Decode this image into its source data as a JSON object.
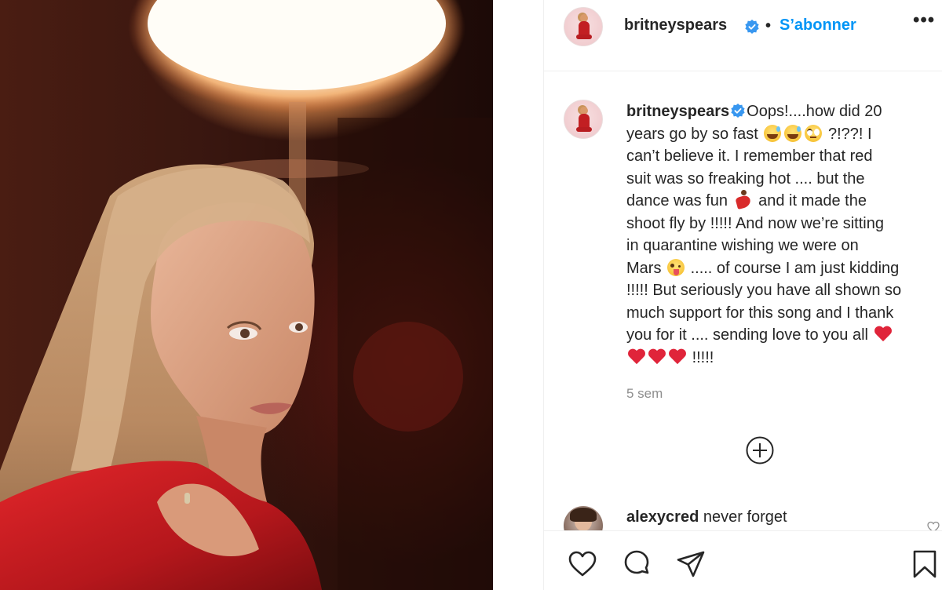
{
  "post": {
    "author": "britneyspears",
    "follow_label": "S’abonner",
    "separator": "•",
    "more_label": "•••"
  },
  "caption": {
    "author": "britneyspears",
    "line1_text": "Oops!....how did 20",
    "line2_a": "years go by so fast",
    "line2_b": "?!??! I",
    "line3": "can’t believe it. I remember that red",
    "line4": "suit was so freaking hot .... but the",
    "line5_a": "dance was fun",
    "line5_b": "and it made the",
    "line6": "shoot fly by !!!!! And now we’re sitting",
    "line7": "in quarantine wishing we were on",
    "line8_a": "Mars",
    "line8_b": "..... of course I am just kidding",
    "line9": "!!!!! But seriously you have all shown so",
    "line10": "much support for this song and I thank",
    "line11": "you for it .... sending love to you all",
    "line12_b": "!!!!!"
  },
  "timestamp": "5 sem",
  "comment": {
    "author": "alexycred",
    "text": "never forget"
  },
  "icons": {
    "verified": "verified-badge-icon",
    "load_more": "plus-circle-icon",
    "like": "heart-outline-icon",
    "comment": "comment-bubble-icon",
    "share": "paper-plane-icon",
    "save": "bookmark-icon"
  },
  "colors": {
    "accent": "#0095f6",
    "text": "#262626",
    "muted": "#8e8e8e",
    "heart": "#e0243a"
  }
}
